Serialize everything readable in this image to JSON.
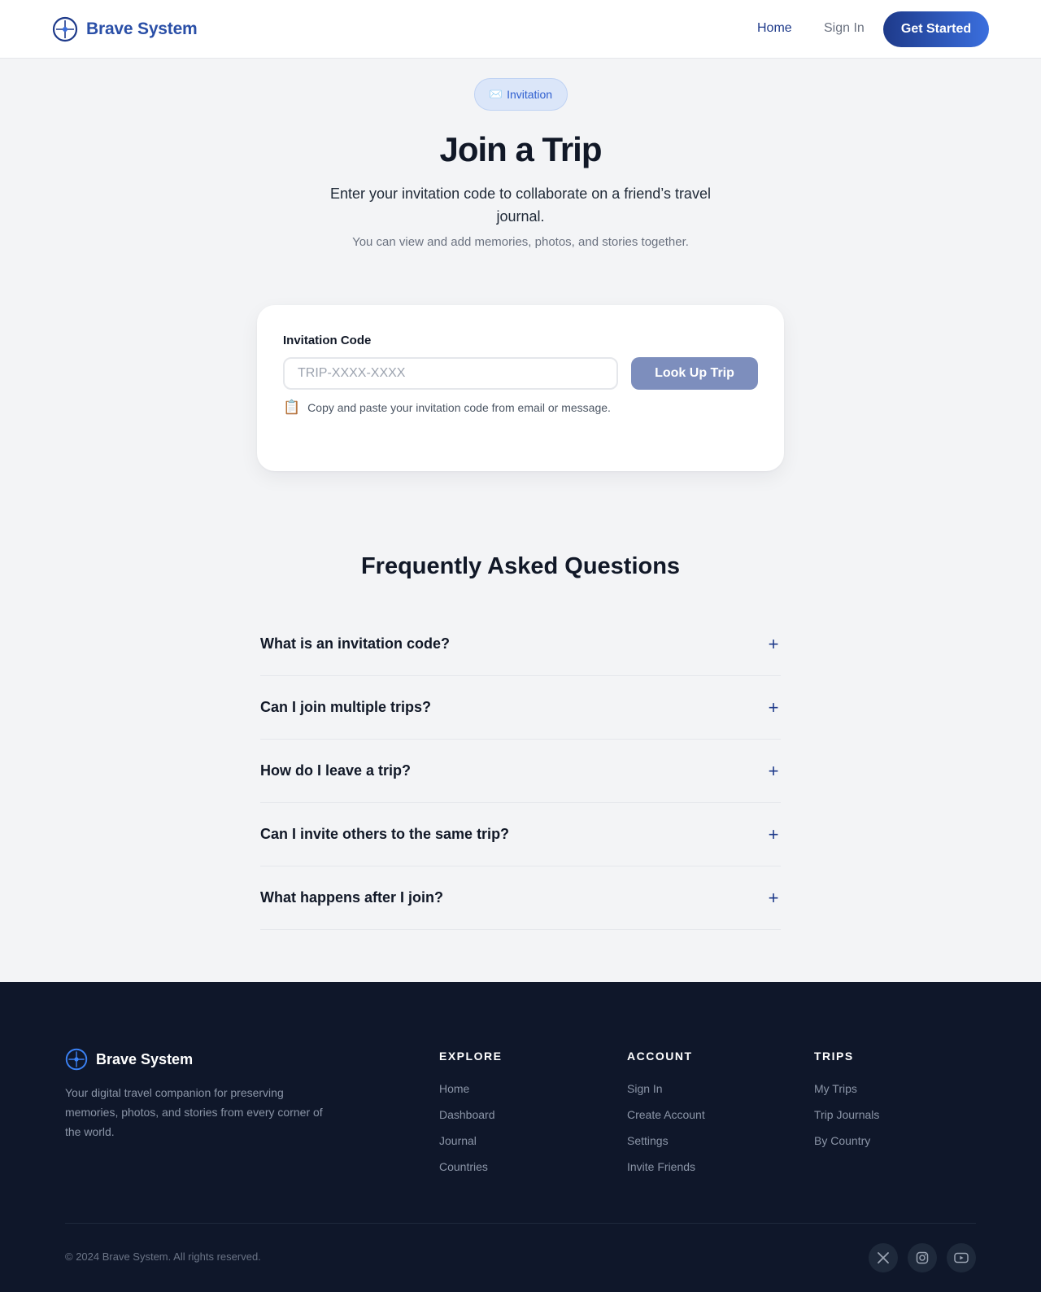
{
  "header": {
    "brand_name": "Brave System",
    "nav_home": "Home",
    "nav_signin": "Sign In",
    "cta": "Get Started"
  },
  "hero": {
    "badge_icon": "✉️",
    "badge_text": "Invitation",
    "title": "Join a Trip",
    "subtitle": "Enter your invitation code to collaborate on a friend’s travel journal.",
    "note": "You can view and add memories, photos, and stories together."
  },
  "form": {
    "label": "Invitation Code",
    "placeholder": "TRIP-XXXX-XXXX",
    "value": "",
    "button": "Look Up Trip",
    "hint_icon": "📋",
    "hint": "Copy and paste your invitation code from email or message."
  },
  "faq": {
    "title": "Frequently Asked Questions",
    "items": [
      {
        "question": "What is an invitation code?",
        "icon": "+"
      },
      {
        "question": "Can I join multiple trips?",
        "icon": "+"
      },
      {
        "question": "How do I leave a trip?",
        "icon": "+"
      },
      {
        "question": "Can I invite others to the same trip?",
        "icon": "+"
      },
      {
        "question": "What happens after I join?",
        "icon": "+"
      }
    ]
  },
  "footer": {
    "brand_name": "Brave System",
    "description": "Your digital travel companion for preserving memories, photos, and stories from every corner of the world.",
    "columns": [
      {
        "title": "EXPLORE",
        "links": [
          "Home",
          "Dashboard",
          "Journal",
          "Countries"
        ]
      },
      {
        "title": "ACCOUNT",
        "links": [
          "Sign In",
          "Create Account",
          "Settings",
          "Invite Friends"
        ]
      },
      {
        "title": "TRIPS",
        "links": [
          "My Trips",
          "Trip Journals",
          "By Country"
        ]
      }
    ],
    "copyright": "© 2024 Brave System. All rights reserved.",
    "social": [
      "x-icon",
      "instagram-icon",
      "youtube-icon"
    ]
  },
  "colors": {
    "brand_primary": "#1e3a8a",
    "brand_accent": "#3b6fde",
    "footer_bg": "#0f172a",
    "page_bg": "#f3f4f6",
    "lookup_button": "#7d8ebd"
  }
}
